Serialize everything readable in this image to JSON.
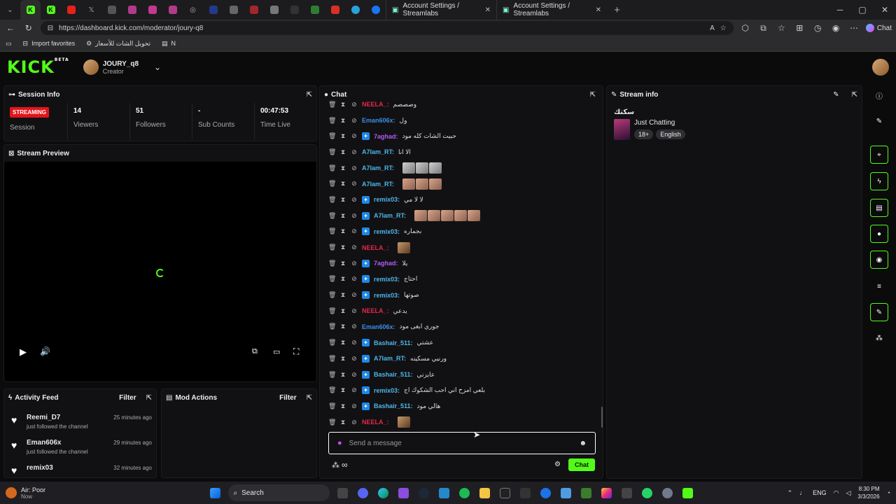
{
  "browser": {
    "tabs": [
      {
        "label": "Account Settings / Streamlabs"
      },
      {
        "label": "Account Settings / Streamlabs"
      }
    ],
    "url": "https://dashboard.kick.com/moderator/joury-q8",
    "copilot_label": "Chat",
    "bookmarks": [
      "Import favorites",
      "تحويل الشات للأسعار",
      "N"
    ]
  },
  "header": {
    "logo": "KICK",
    "logo_badge": "BETA",
    "channel_name": "JOURY_q8",
    "channel_role": "Creator"
  },
  "session": {
    "title": "Session Info",
    "status_badge": "STREAMING",
    "status_label": "Session",
    "stats": [
      {
        "value": "14",
        "label": "Viewers"
      },
      {
        "value": "51",
        "label": "Followers"
      },
      {
        "value": "-",
        "label": "Sub Counts"
      },
      {
        "value": "00:47:53",
        "label": "Time Live"
      }
    ]
  },
  "preview": {
    "title": "Stream Preview"
  },
  "activity": {
    "title": "Activity Feed",
    "filter": "Filter",
    "items": [
      {
        "user": "Reemi_D7",
        "action": "just followed the channel",
        "time": "25 minutes ago"
      },
      {
        "user": "Eman606x",
        "action": "just followed the channel",
        "time": "29 minutes ago"
      },
      {
        "user": "remix03",
        "action": "",
        "time": "32 minutes ago"
      }
    ]
  },
  "mod_actions": {
    "title": "Mod Actions",
    "filter": "Filter"
  },
  "chat": {
    "title": "Chat",
    "input_placeholder": "Send a message",
    "send_label": "Chat",
    "messages": [
      {
        "user": "NEELA_:",
        "color": "#e5274b",
        "text": "وصصصم",
        "badge": false
      },
      {
        "user": "Eman606x:",
        "color": "#3b8ee8",
        "text": "ول",
        "badge": false
      },
      {
        "user": "7aghad:",
        "color": "#b05cf0",
        "text": "حبيت الشات كله مود",
        "badge": true
      },
      {
        "user": "A7lam_RT:",
        "color": "#4db6e8",
        "text": "الا انا",
        "badge": false
      },
      {
        "user": "A7lam_RT:",
        "color": "#4db6e8",
        "text": "",
        "badge": false,
        "emotes": 3,
        "emote": "emo2"
      },
      {
        "user": "A7lam_RT:",
        "color": "#4db6e8",
        "text": "",
        "badge": false,
        "emotes": 3,
        "emote": "emo1"
      },
      {
        "user": "remix03:",
        "color": "#4db6e8",
        "text": "لا لا مي",
        "badge": true
      },
      {
        "user": "A7lam_RT:",
        "color": "#4db6e8",
        "text": "",
        "badge": true,
        "emotes": 5,
        "emote": "emo1"
      },
      {
        "user": "remix03:",
        "color": "#4db6e8",
        "text": "بجماره",
        "badge": true
      },
      {
        "user": "NEELA_:",
        "color": "#e5274b",
        "text": "",
        "badge": false,
        "emotes": 1,
        "emote": "emo3"
      },
      {
        "user": "7aghad:",
        "color": "#b05cf0",
        "text": "يلا",
        "badge": true
      },
      {
        "user": "remix03:",
        "color": "#4db6e8",
        "text": "احتاج",
        "badge": true
      },
      {
        "user": "remix03:",
        "color": "#4db6e8",
        "text": "صوتها",
        "badge": true
      },
      {
        "user": "NEELA_:",
        "color": "#e5274b",
        "text": "يدعي",
        "badge": false
      },
      {
        "user": "Eman606x:",
        "color": "#3b8ee8",
        "text": "جوري ابغى مود",
        "badge": false
      },
      {
        "user": "Bashair_511:",
        "color": "#4db6e8",
        "text": "عشتي",
        "badge": true
      },
      {
        "user": "A7lam_RT:",
        "color": "#4db6e8",
        "text": "ورنيي مسكينه",
        "badge": true
      },
      {
        "user": "Bashair_511:",
        "color": "#4db6e8",
        "text": "عايزني",
        "badge": true
      },
      {
        "user": "remix03:",
        "color": "#4db6e8",
        "text": "بلعي امزح اني احب الشكوك اج",
        "badge": true
      },
      {
        "user": "Bashair_511:",
        "color": "#4db6e8",
        "text": "هالي مود",
        "badge": true
      },
      {
        "user": "NEELA_:",
        "color": "#e5274b",
        "text": "",
        "badge": false,
        "emotes": 1,
        "emote": "emo3"
      }
    ]
  },
  "stream_info": {
    "title": "Stream info",
    "stream_title": "سكتك",
    "category": "Just Chatting",
    "tags": [
      "18+",
      "English"
    ]
  },
  "taskbar": {
    "weather_title": "Air: Poor",
    "weather_sub": "Now",
    "search": "Search",
    "lang": "ENG",
    "time": "8:30 PM",
    "date": "3/3/2026"
  },
  "colors": {
    "accent": "#53fc18",
    "live": "#e3141b"
  }
}
